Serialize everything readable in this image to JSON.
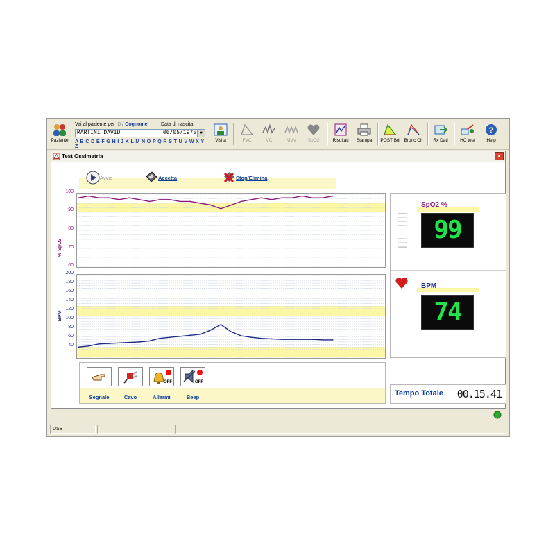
{
  "toolbar": {
    "paziente_label": "Paziente",
    "search": {
      "label_prefix": "Vai al paziente per",
      "label_id": "ID",
      "label_cognome": "/ Cognome",
      "label_dob": "Data di nascita",
      "patient_name": "MARTINI DAVID",
      "patient_dob": "06/05/1975",
      "alphabet": "A B C D E F G H I J K L M N O P Q R S T U V W X Y Z"
    },
    "buttons": {
      "visita": "Visita",
      "fvc": "FVC",
      "vc": "VC",
      "mvv": "MVV",
      "spo2": "SpO2",
      "risultati": "Risultati",
      "stampa": "Stampa",
      "post_bd": "POST Bd",
      "bronc_ch": "Bronc Ch",
      "rx_dati": "Rx Dati",
      "hc_test": "HC test",
      "help": "Help"
    }
  },
  "window": {
    "title": "Test Ossimetria",
    "close": "×"
  },
  "actions": {
    "avvio": "Avvio",
    "accetta": "Accetta",
    "stop": "Stop/Elimina"
  },
  "spo2_chart": {
    "ylabel": "% SpO2",
    "ticks": [
      "100",
      "90",
      "80",
      "70",
      "60"
    ],
    "ylim": [
      60,
      100
    ]
  },
  "bpm_chart": {
    "ylabel": "BPM",
    "ticks": [
      "200",
      "180",
      "160",
      "140",
      "120",
      "100",
      "80",
      "60",
      "40"
    ],
    "ylim": [
      40,
      200
    ]
  },
  "chart_data": [
    {
      "type": "line",
      "ylabel": "% SpO2",
      "ylim": [
        60,
        100
      ],
      "x": [
        0,
        4,
        8,
        12,
        16,
        20,
        24,
        28,
        32,
        36,
        40,
        44,
        48,
        52,
        56,
        60,
        64,
        68,
        72,
        76,
        80,
        84,
        88,
        92,
        96,
        100
      ],
      "values": [
        98,
        99,
        98,
        98,
        97,
        98,
        97,
        96,
        97,
        97,
        96,
        96,
        95,
        94,
        92,
        94,
        96,
        97,
        98,
        97,
        98,
        98,
        99,
        98,
        98,
        99
      ],
      "color": "#8b1a7c"
    },
    {
      "type": "line",
      "ylabel": "BPM",
      "ylim": [
        40,
        200
      ],
      "x": [
        0,
        4,
        8,
        12,
        16,
        20,
        24,
        28,
        32,
        36,
        40,
        44,
        48,
        52,
        56,
        60,
        64,
        68,
        72,
        76,
        80,
        84,
        88,
        92,
        96,
        100
      ],
      "values": [
        60,
        62,
        66,
        67,
        68,
        69,
        70,
        72,
        77,
        79,
        81,
        83,
        85,
        93,
        104,
        90,
        82,
        79,
        77,
        76,
        75,
        75,
        75,
        75,
        74,
        74
      ],
      "color": "#1f2a86"
    }
  ],
  "spo2_panel": {
    "title": "SpO2  %",
    "value": "99"
  },
  "bpm_panel": {
    "title": "BPM",
    "value": "74"
  },
  "icons": {
    "segnale": "Segnale",
    "cavo": "Cavo",
    "allarmi": "Allarmi",
    "beep": "Beep",
    "off": "OFF"
  },
  "tempo": {
    "label": "Tempo Totale",
    "value": "00.15.41"
  },
  "status": {
    "port": "USB"
  }
}
